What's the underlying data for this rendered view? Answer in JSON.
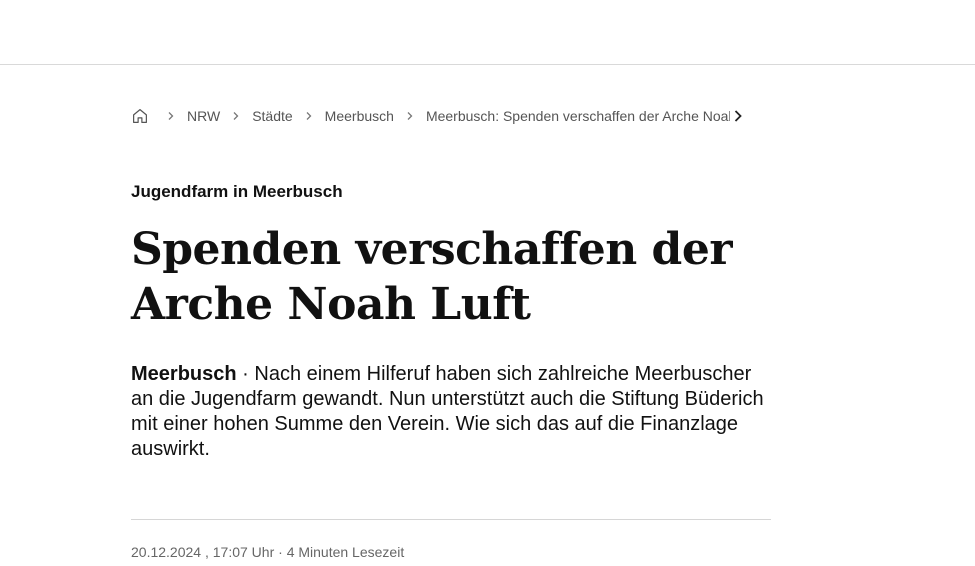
{
  "breadcrumb": {
    "home_icon": "home-icon",
    "separator_icon": "chevron-right-icon",
    "items": [
      "NRW",
      "Städte",
      "Meerbusch"
    ],
    "current": "Meerbusch: Spenden verschaffen der Arche Noah Luft"
  },
  "article": {
    "kicker": "Jugendfarm in Meerbusch",
    "headline": "Spenden verschaffen der Arche Noah Luft",
    "dateline": "Meerbusch",
    "teaser_separator": " · ",
    "teaser": "Nach einem Hilferuf haben sich zahlreiche Meerbuscher an die Jugendfarm gewandt. Nun unterstützt auch die Stiftung Büderich mit einer hohen Summe den Verein. Wie sich das auf die Finanzlage auswirkt.",
    "date": "20.12.2024",
    "time": "17:07 Uhr",
    "reading_time": "4 Minuten Lesezeit"
  }
}
